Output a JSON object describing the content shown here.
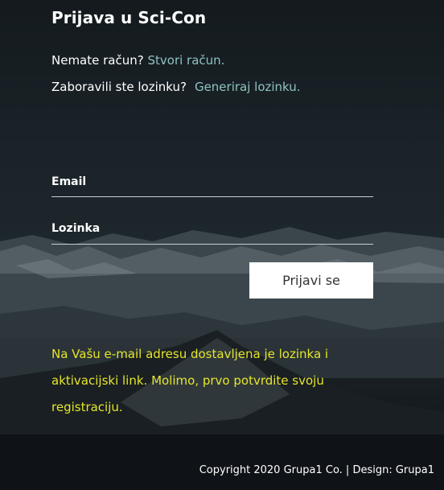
{
  "login": {
    "title": "Prijava u Sci-Con",
    "no_account_text": "Nemate račun?",
    "create_account_link": "Stvori račun.",
    "forgot_text": "Zaboravili ste lozinku?",
    "generate_password_link": "Generiraj lozinku.",
    "email_label": "Email",
    "password_label": "Lozinka",
    "submit_label": "Prijavi se",
    "notice": "Na Vašu e-mail adresu dostavljena je lozinka i aktivacijski link. Molimo, prvo potvrdite svoju registraciju."
  },
  "footer": {
    "copyright": "Copyright 2020 Grupa1 Co. | Design: Grupa1"
  },
  "colors": {
    "link": "#8fc3c0",
    "notice": "#e5e52a",
    "button_bg": "#ffffff"
  }
}
